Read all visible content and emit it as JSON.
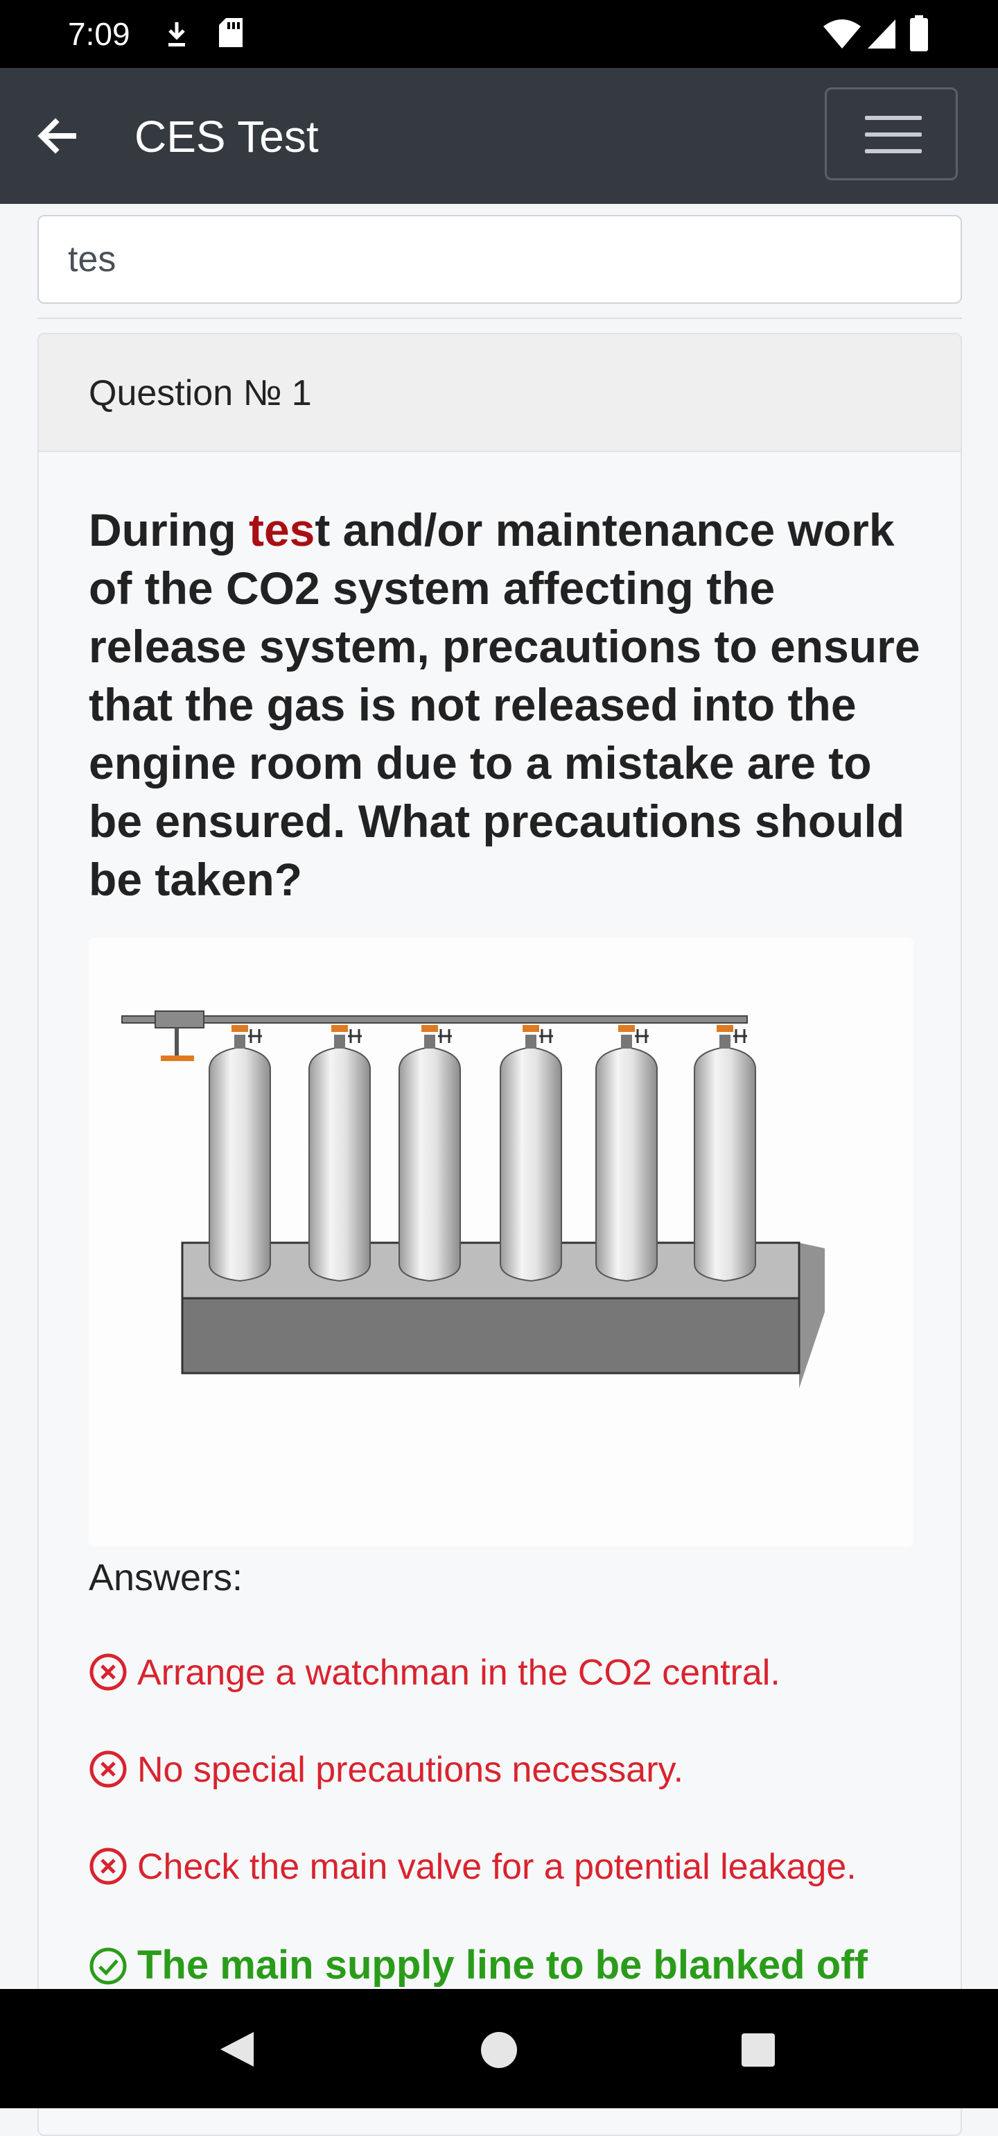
{
  "status_bar": {
    "time": "7:09"
  },
  "app_bar": {
    "title": "CES Test"
  },
  "search": {
    "value": "tes"
  },
  "question": {
    "header": "Question № 1",
    "text_highlight": "tes",
    "text_rest": "t and/or maintenance work of the CO2 system affecting the release system, precautions to ensure that the gas is not released into the engine room due to a mistake are to be ensured. What precautions should be taken?",
    "text_prefix": "During "
  },
  "answers": {
    "label": "Answers:",
    "items": [
      {
        "text": "Arrange a watchman in the CO2 central.",
        "status": "incorrect"
      },
      {
        "text": "No special precautions necessary.",
        "status": "incorrect"
      },
      {
        "text": "Check the main valve for a potential leakage.",
        "status": "incorrect"
      },
      {
        "text": "The main supply line to be blanked off",
        "status": "correct"
      }
    ]
  },
  "colors": {
    "incorrect": "#d9232e",
    "correct": "#2a9c1a",
    "highlight": "#a90f12",
    "app_bar": "#343a40"
  },
  "icons": [
    "download-icon",
    "sd-card-icon",
    "wifi-icon",
    "signal-icon",
    "battery-icon",
    "back-arrow-icon",
    "hamburger-menu-icon",
    "nav-back-icon",
    "nav-home-icon",
    "nav-recents-icon"
  ]
}
